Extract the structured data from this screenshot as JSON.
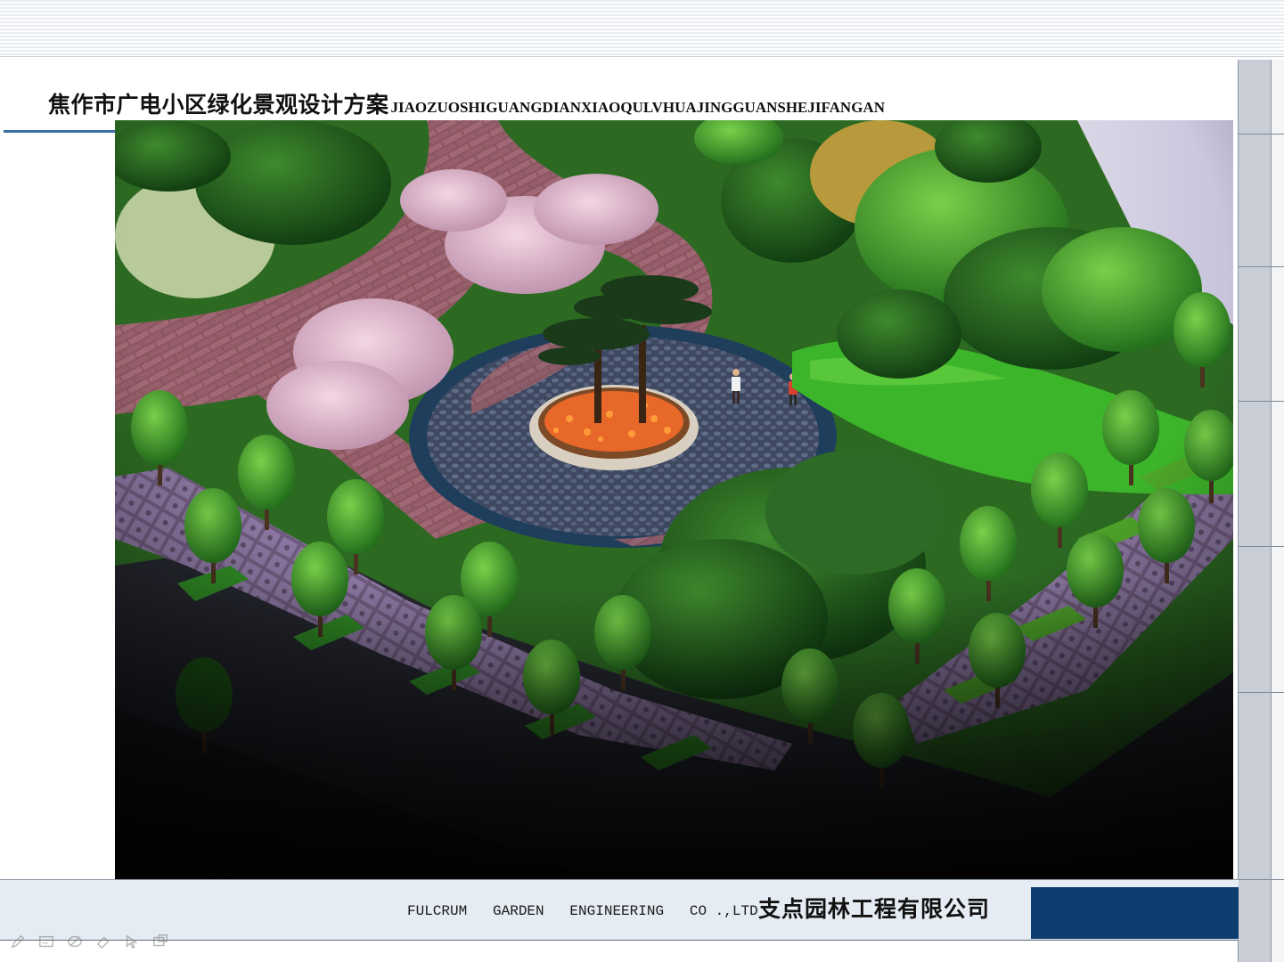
{
  "slide": {
    "title_zh": "焦作市广电小区绿化景观设计方案",
    "title_en": "JIAOZUOSHIGUANGDIANXIAOQULVHUAJINGGUANSHEJIFANGAN"
  },
  "footer": {
    "company_en": "FULCRUM   GARDEN   ENGINEERING   CO .,LTD",
    "company_zh": "支点园林工程有限公司"
  },
  "toolbar": {
    "tools": [
      "pen-icon",
      "slides-icon",
      "highlighter-icon",
      "eraser-icon",
      "pointer-icon",
      "screen-icon"
    ]
  },
  "colors": {
    "accent_blue": "#3b6fa5",
    "footer_navy": "#0d3c6e",
    "panel_gray": "#c9ced6"
  }
}
